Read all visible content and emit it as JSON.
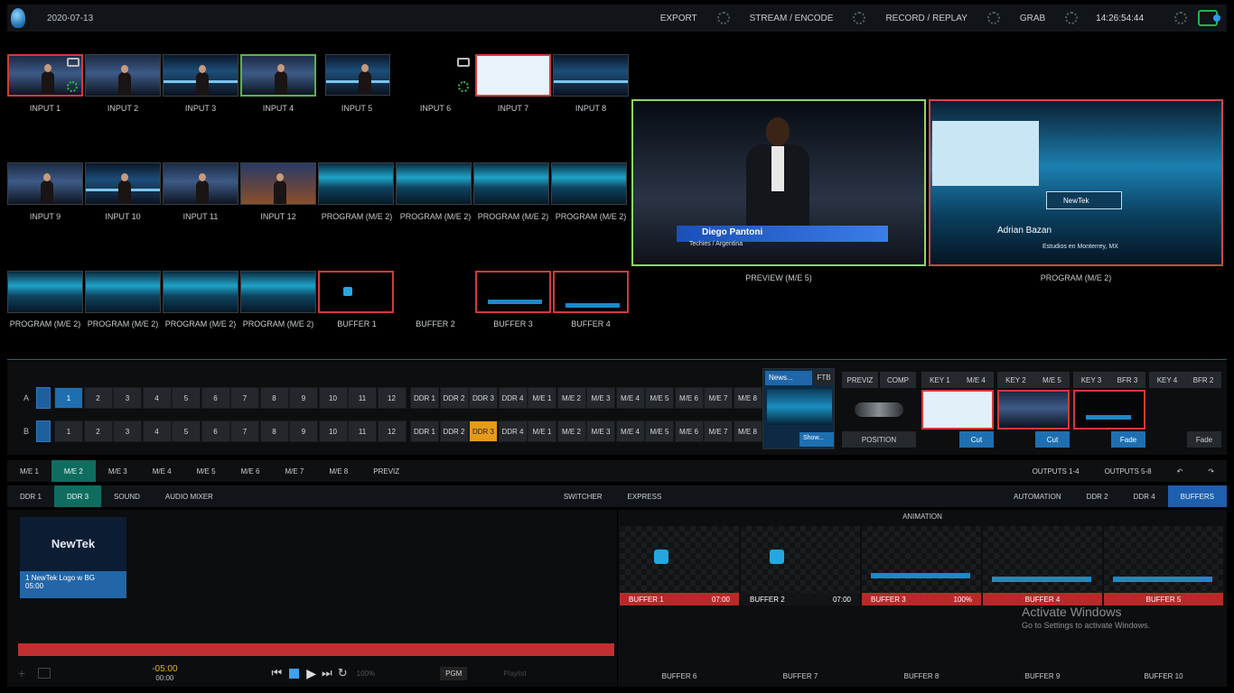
{
  "topbar": {
    "date": "2020-07-13",
    "items": [
      "EXPORT",
      "STREAM / ENCODE",
      "RECORD / REPLAY",
      "GRAB"
    ],
    "clock": "14:26:54:44"
  },
  "sources": {
    "row1": [
      "INPUT 1",
      "INPUT 2",
      "INPUT 3",
      "INPUT 4",
      "INPUT 5",
      "INPUT 6",
      "INPUT 7",
      "INPUT 8"
    ],
    "row2": [
      "INPUT 9",
      "INPUT 10",
      "INPUT 11",
      "INPUT 12",
      "PROGRAM (M/E 2)",
      "PROGRAM (M/E 2)",
      "PROGRAM (M/E 2)",
      "PROGRAM (M/E 2)"
    ],
    "row3": [
      "PROGRAM (M/E 2)",
      "PROGRAM (M/E 2)",
      "PROGRAM (M/E 2)",
      "PROGRAM (M/E 2)",
      "BUFFER 1",
      "BUFFER 2",
      "BUFFER 3",
      "BUFFER 4"
    ]
  },
  "monitors": {
    "preview_label": "PREVIEW (M/E 5)",
    "program_label": "PROGRAM (M/E 2)",
    "preview_name": "Diego Pantoni",
    "preview_sub": "Techies / Argentina",
    "program_name": "Adrian Bazan",
    "program_sub": "Estudios en Monterrey, MX",
    "program_logo": "NewTek"
  },
  "switcher": {
    "row_a_label": "A",
    "row_b_label": "B",
    "numbers": [
      "1",
      "2",
      "3",
      "4",
      "5",
      "6",
      "7",
      "8",
      "9",
      "10",
      "11",
      "12"
    ],
    "ddr": [
      "DDR 1",
      "DDR 2",
      "DDR 3",
      "DDR 4"
    ],
    "me": [
      "M/E 1",
      "M/E 2",
      "M/E 3",
      "M/E 4",
      "M/E 5",
      "M/E 6",
      "M/E 7",
      "M/E 8"
    ],
    "news_label": "News...",
    "ftb": "FTB",
    "show_label": "Show...",
    "previz": "PREVIZ",
    "comp": "COMP",
    "position": "POSITION",
    "keys": [
      {
        "key": "KEY 1",
        "src": "M/E 4",
        "action": "Cut"
      },
      {
        "key": "KEY 2",
        "src": "M/E 5",
        "action": "Cut"
      },
      {
        "key": "KEY 3",
        "src": "BFR 3",
        "action": "Fade"
      },
      {
        "key": "KEY 4",
        "src": "BFR 2",
        "action": "Fade"
      }
    ]
  },
  "me_tabs": [
    "M/E 1",
    "M/E 2",
    "M/E 3",
    "M/E 4",
    "M/E 5",
    "M/E 6",
    "M/E 7",
    "M/E 8",
    "PREVIZ"
  ],
  "outputs": [
    "OUTPUTS 1-4",
    "OUTPUTS 5-8"
  ],
  "panel_tabs_left": [
    "DDR 1",
    "DDR 3",
    "SOUND",
    "AUDIO MIXER"
  ],
  "panel_tabs_mid": [
    "SWITCHER",
    "EXPRESS"
  ],
  "panel_tabs_right": [
    "AUTOMATION",
    "DDR 2",
    "DDR 4",
    "BUFFERS"
  ],
  "ddr": {
    "logo": "NewTek",
    "clip_name": "NewTek Logo w BG",
    "clip_num": "1",
    "clip_dur": "05:00",
    "time_main": "-05:00",
    "time_sub": "00:00",
    "speed": "100%",
    "pgm": "PGM",
    "playlist": "Playlist"
  },
  "animation": {
    "title": "ANIMATION",
    "buffers": [
      {
        "name": "BUFFER 1",
        "val": "07:00"
      },
      {
        "name": "BUFFER 2",
        "val": "07:00"
      },
      {
        "name": "BUFFER 3",
        "val": "100%"
      },
      {
        "name": "BUFFER 4",
        "val": ""
      },
      {
        "name": "BUFFER 5",
        "val": ""
      }
    ],
    "bottom": [
      "BUFFER 6",
      "BUFFER 7",
      "BUFFER 8",
      "BUFFER 9",
      "BUFFER 10"
    ]
  },
  "watermark": {
    "line1": "Activate Windows",
    "line2": "Go to Settings to activate Windows."
  }
}
